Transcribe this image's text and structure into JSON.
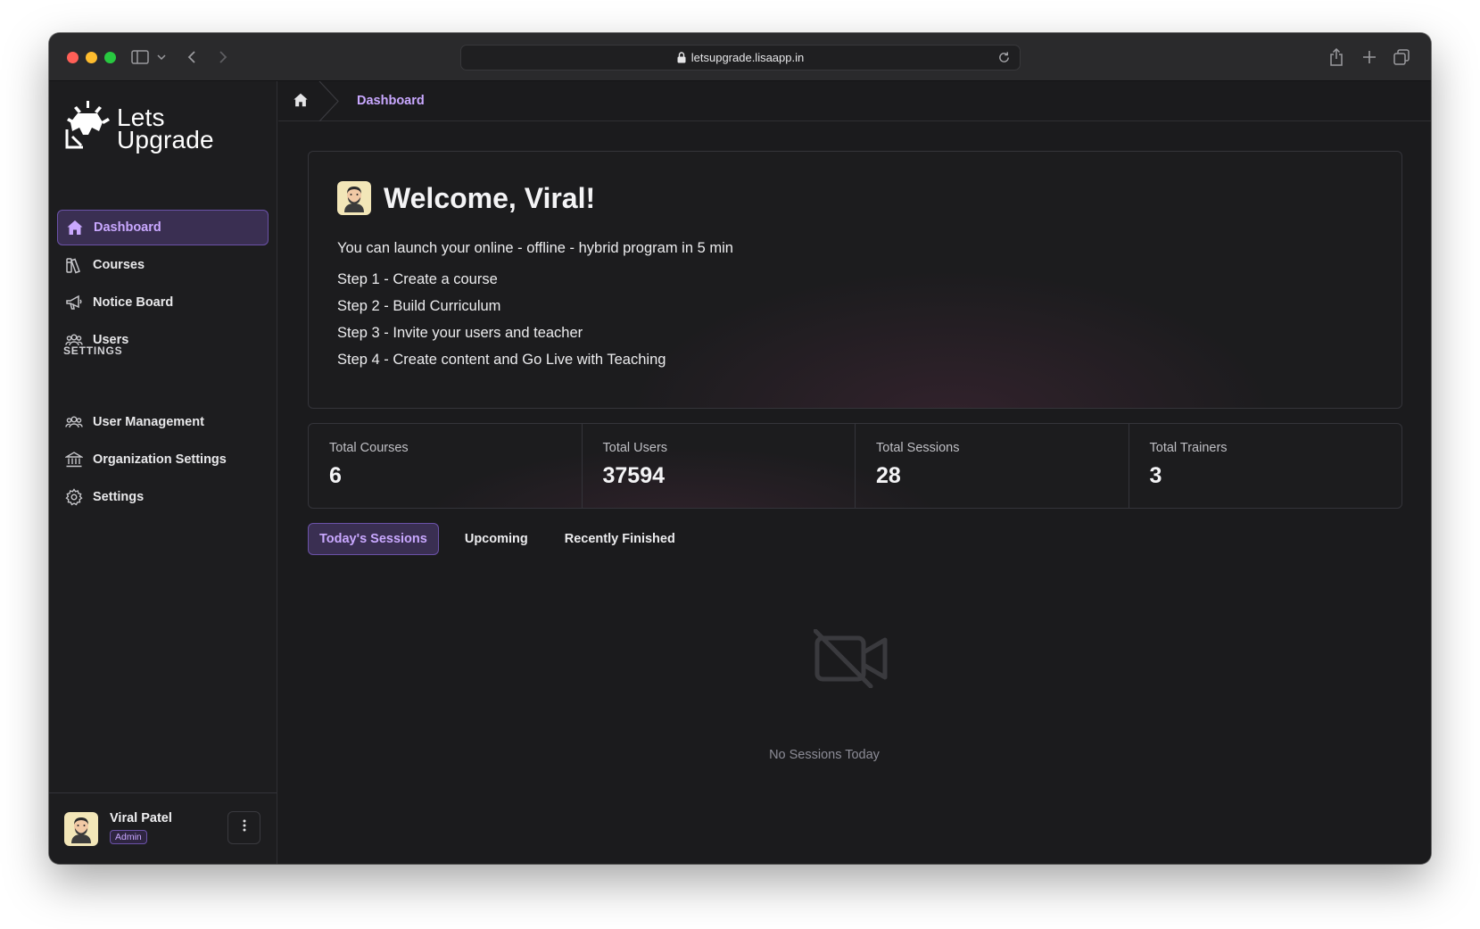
{
  "browser": {
    "url": "letsupgrade.lisaapp.in"
  },
  "brand": {
    "name_line1": "Lets",
    "name_line2": "Upgrade",
    "accent": "#c9a8ff"
  },
  "sidebar": {
    "items": [
      {
        "label": "Dashboard",
        "icon": "home-icon",
        "active": true
      },
      {
        "label": "Courses",
        "icon": "book-icon",
        "active": false
      },
      {
        "label": "Notice Board",
        "icon": "megaphone-icon",
        "active": false
      },
      {
        "label": "Users",
        "icon": "users-icon",
        "active": false
      }
    ],
    "settings_label": "SETTINGS",
    "settings_items": [
      {
        "label": "User Management",
        "icon": "users-icon"
      },
      {
        "label": "Organization Settings",
        "icon": "bank-icon"
      },
      {
        "label": "Settings",
        "icon": "gear-icon"
      }
    ],
    "user": {
      "name": "Viral Patel",
      "role": "Admin"
    }
  },
  "breadcrumb": {
    "current": "Dashboard"
  },
  "welcome": {
    "title": "Welcome, Viral!",
    "intro": "You can launch your online - offline - hybrid program in 5 min",
    "steps": [
      "Step 1 - Create a course",
      "Step 2 - Build Curriculum",
      "Step 3 - Invite your users and teacher",
      "Step 4 - Create content and Go Live with Teaching"
    ]
  },
  "stats": [
    {
      "label": "Total Courses",
      "value": "6"
    },
    {
      "label": "Total Users",
      "value": "37594"
    },
    {
      "label": "Total Sessions",
      "value": "28"
    },
    {
      "label": "Total Trainers",
      "value": "3"
    }
  ],
  "tabs": [
    {
      "label": "Today's Sessions",
      "active": true
    },
    {
      "label": "Upcoming",
      "active": false
    },
    {
      "label": "Recently Finished",
      "active": false
    }
  ],
  "empty_state": {
    "icon": "video-off-icon",
    "text": "No Sessions Today"
  }
}
